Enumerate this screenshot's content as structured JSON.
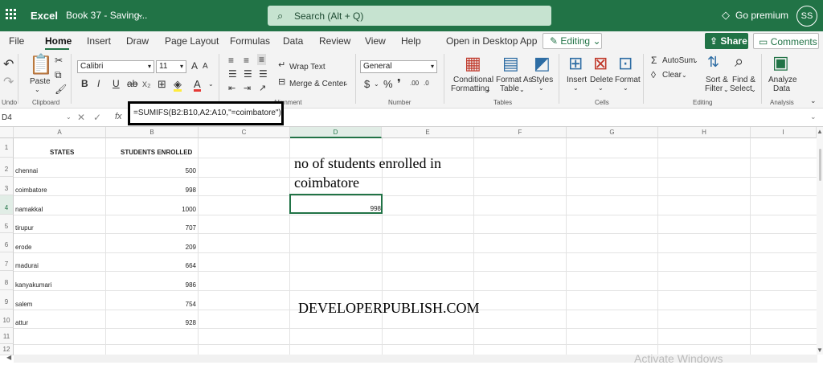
{
  "titlebar": {
    "app_name": "Excel",
    "doc_name": "Book 37 - Saving...",
    "search_placeholder": "Search (Alt + Q)",
    "go_premium": "Go premium",
    "user_initials": "SS"
  },
  "menu": {
    "tabs": [
      "File",
      "Home",
      "Insert",
      "Draw",
      "Page Layout",
      "Formulas",
      "Data",
      "Review",
      "View",
      "Help",
      "Open in Desktop App"
    ],
    "active_tab": "Home",
    "editing_label": "Editing",
    "share_label": "Share",
    "comments_label": "Comments"
  },
  "ribbon": {
    "undo_group": "Undo",
    "paste_label": "Paste",
    "clipboard_group": "Clipboard",
    "font_name": "Calibri",
    "font_size": "11",
    "bold": "B",
    "italic": "I",
    "underline": "U",
    "wrap_text": "Wrap Text",
    "merge_center": "Merge & Center",
    "alignment_group": "Alignment",
    "number_format": "General",
    "number_group": "Number",
    "conditional_formatting_1": "Conditional",
    "conditional_formatting_2": "Formatting",
    "format_as_table_1": "Format As",
    "format_as_table_2": "Table",
    "styles": "Styles",
    "tables_group": "Tables",
    "insert": "Insert",
    "delete": "Delete",
    "format": "Format",
    "cells_group": "Cells",
    "autosum": "AutoSum",
    "clear": "Clear",
    "sort_filter_1": "Sort &",
    "sort_filter_2": "Filter",
    "find_select_1": "Find &",
    "find_select_2": "Select",
    "editing_group": "Editing",
    "analyze_data_1": "Analyze",
    "analyze_data_2": "Data",
    "analysis_group": "Analysis"
  },
  "formula_bar": {
    "name_box": "D4",
    "fx": "fx",
    "formula": "=SUMIFS(B2:B10,A2:A10,\"=coimbatore\")"
  },
  "sheet": {
    "columns": [
      "A",
      "B",
      "C",
      "D",
      "E",
      "F",
      "G",
      "H",
      "I"
    ],
    "rows": [
      "1",
      "2",
      "3",
      "4",
      "5",
      "6",
      "7",
      "8",
      "9",
      "10",
      "11",
      "12"
    ],
    "header_a": "STATES",
    "header_b": "STUDENTS ENROLLED",
    "data": [
      {
        "state": "chennai",
        "enrolled": "500"
      },
      {
        "state": "coimbatore",
        "enrolled": "998"
      },
      {
        "state": "namakkal",
        "enrolled": "1000"
      },
      {
        "state": "tirupur",
        "enrolled": "707"
      },
      {
        "state": "erode",
        "enrolled": "209"
      },
      {
        "state": "madurai",
        "enrolled": "664"
      },
      {
        "state": "kanyakumari",
        "enrolled": "986"
      },
      {
        "state": "salem",
        "enrolled": "754"
      },
      {
        "state": "attur",
        "enrolled": "928"
      }
    ],
    "note_line1": "no of students enrolled in",
    "note_line2": "coimbatore",
    "result": "998",
    "site_label": "DEVELOPERPUBLISH.COM"
  },
  "watermark": "Activate Windows",
  "colors": {
    "excel_green": "#217346",
    "search_bg": "#c6e3d0"
  }
}
